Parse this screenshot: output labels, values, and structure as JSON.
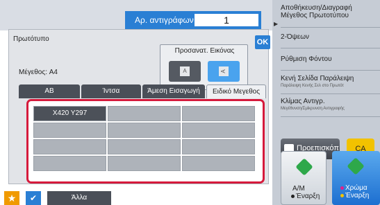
{
  "header": {
    "copies_label": "Αρ. αντιγράφων",
    "copies_value": "1"
  },
  "right_panel": {
    "items": [
      {
        "label": "Αποθήκευση/Διαγραφή Μέγεθος Πρωτοτύπου",
        "sub": ""
      },
      {
        "label": "2-Όψεων",
        "sub": ""
      },
      {
        "label": "Ρύθμιση Φόντου",
        "sub": ""
      },
      {
        "label": "Κενή Σελίδα Παράλειψη",
        "sub": "Παράλειψη Κενής Σελ στο Πρωτότ"
      },
      {
        "label": "Κλίμας Αντιγρ.",
        "sub": "Μεγέθυνση/Σμίκρυνση Αντιγραφής"
      }
    ],
    "preview_label": "Προεπισκόπ",
    "ca_label": "CA",
    "start_bw_label": "Α/Μ",
    "start_bw_sub": "Έναρξη",
    "start_color_label": "Χρώμα",
    "start_color_sub": "Έναρξη"
  },
  "dialog": {
    "title": "Πρωτότυπο",
    "ok_label": "OK",
    "size_label": "Μέγεθος: A4",
    "orientation_title": "Προσανατ. Εικόνας",
    "orientation_glyphs": [
      "A",
      "A"
    ],
    "tabs": [
      "AB",
      "Ίντσα",
      "Άμεση Εισαγωγή",
      "Ειδικό Μεγεθος"
    ],
    "active_tab": 3,
    "custom_sizes": [
      "X420 Y297",
      "",
      "",
      "",
      "",
      "",
      "",
      "",
      "",
      "",
      "",
      ""
    ]
  },
  "bottom_bar": {
    "star_glyph": "★",
    "check_glyph": "✔",
    "other_label": "Άλλα"
  },
  "colors": {
    "accent_blue": "#2a7fd4",
    "highlight_red": "#d61a3c",
    "ca_yellow": "#f2c200",
    "star_orange": "#f09a00"
  }
}
